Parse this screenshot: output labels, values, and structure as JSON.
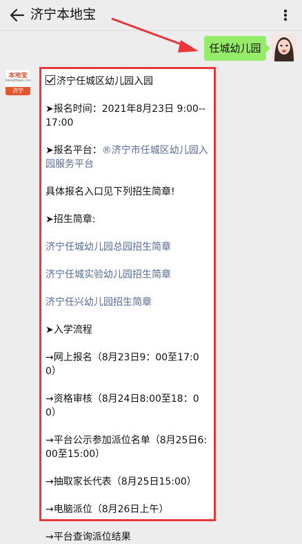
{
  "header": {
    "title": "济宁本地宝",
    "back_icon": "back-arrow-icon",
    "more_icon": "more-icon"
  },
  "chat": {
    "user_message": "任城幼儿园",
    "bot_avatar": {
      "logo_text": "本地宝",
      "logo_sub": "bendibao.com",
      "city": "济宁"
    },
    "reply_lines": [
      {
        "text": "济宁任城区幼儿园入园",
        "style": "checkbox"
      },
      {
        "text": "➤报名时间：2021年8月23日 9:00--17:00",
        "style": "plain"
      },
      {
        "text": "➤报名平台：",
        "link": "®济宁市任城区幼儿园入园服务平台",
        "style": "mixed"
      },
      {
        "text": "具体报名入口见下列招生简章!",
        "style": "plain"
      },
      {
        "text": "➤招生简章:",
        "style": "plain"
      },
      {
        "text": "济宁任城幼儿园总园招生简章",
        "style": "link"
      },
      {
        "text": "济宁任城实验幼儿园招生简章",
        "style": "link"
      },
      {
        "text": "济宁任兴幼儿园招生简章",
        "style": "link"
      },
      {
        "text": "➤入学流程",
        "style": "plain"
      },
      {
        "text": "→网上报名（8月23日9：00至17:00）",
        "style": "plain"
      },
      {
        "text": "→资格审核（8月24日8:00至18：00）",
        "style": "plain"
      },
      {
        "text": "→平台公示参加派位名单（8月25日6:00至15:00）",
        "style": "plain"
      },
      {
        "text": "→抽取家长代表（8月25日15:00）",
        "style": "plain"
      },
      {
        "text": "→电脑派位（8月26日上午）",
        "style": "plain"
      },
      {
        "text": "→平台查询派位结果",
        "style": "plain"
      }
    ]
  },
  "colors": {
    "user_bubble": "#95ec69",
    "highlight_border": "#e8363b",
    "link": "#576b95",
    "background": "#ededed"
  }
}
